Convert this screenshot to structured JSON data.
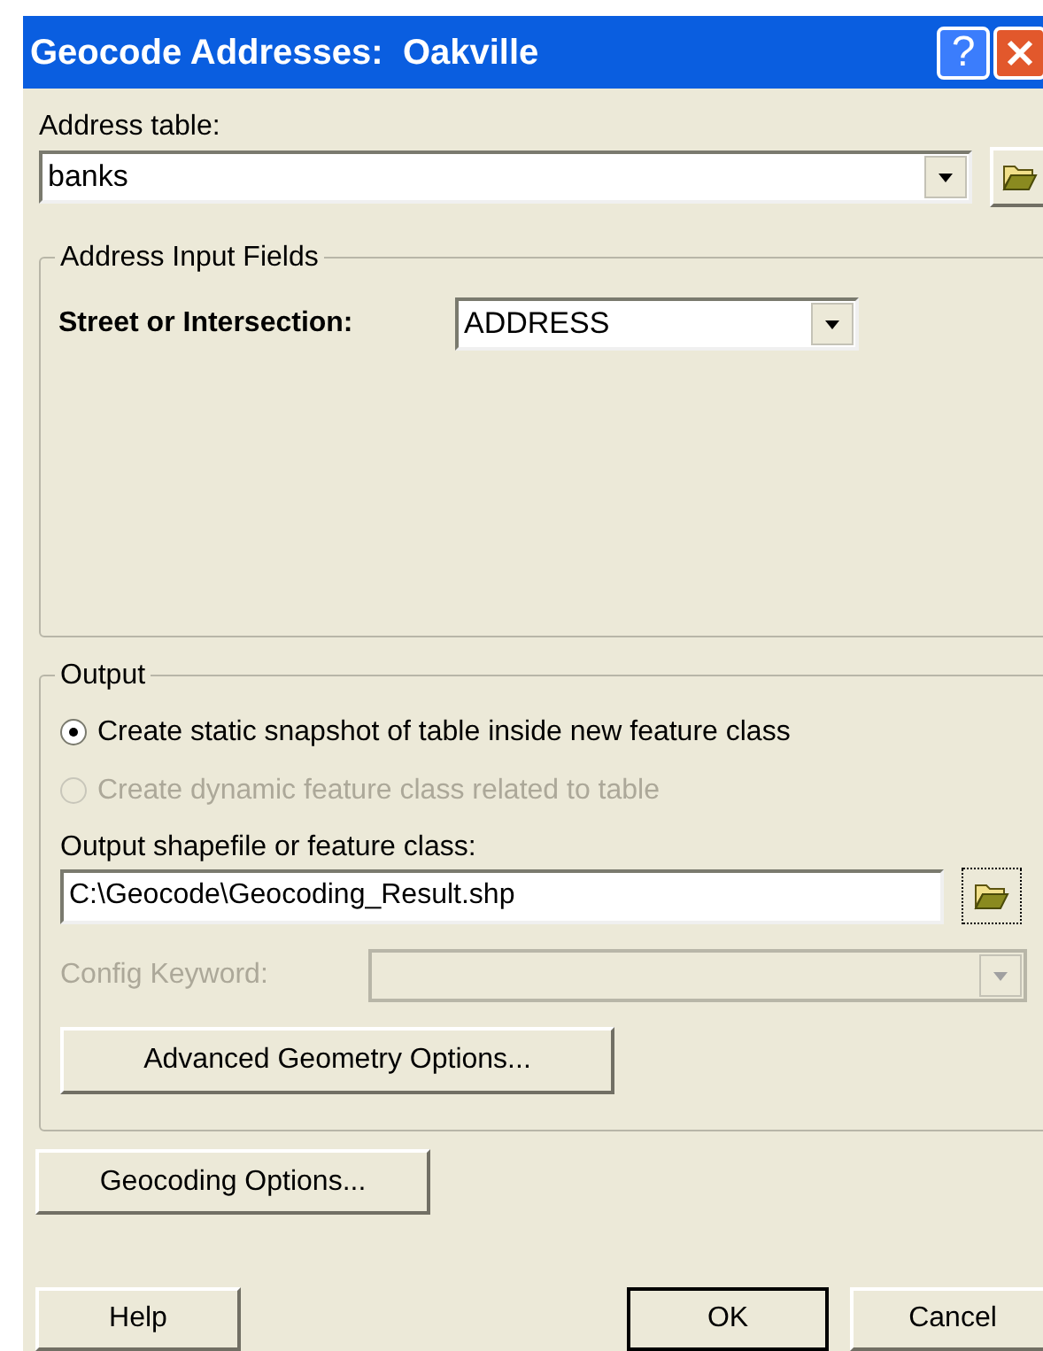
{
  "window": {
    "title": "Geocode Addresses:  Oakville",
    "help_button": "?"
  },
  "address_table": {
    "label": "Address table:",
    "value": "banks"
  },
  "input_fields": {
    "legend": "Address Input Fields",
    "street_label": "Street or Intersection:",
    "street_value": "ADDRESS"
  },
  "output": {
    "legend": "Output",
    "options": [
      {
        "label": "Create static snapshot of table inside new feature class",
        "selected": true,
        "disabled": false
      },
      {
        "label": "Create dynamic feature class related to table",
        "selected": false,
        "disabled": true
      }
    ],
    "path_label": "Output shapefile or feature class:",
    "path_value": "C:\\Geocode\\Geocoding_Result.shp",
    "config_label": "Config Keyword:",
    "config_disabled": true,
    "advanced_button": "Advanced Geometry Options..."
  },
  "geocoding_options_button": "Geocoding Options...",
  "buttons": [
    {
      "label": "Help",
      "default": false
    },
    {
      "label": "OK",
      "default": true
    },
    {
      "label": "Cancel",
      "default": false
    }
  ]
}
